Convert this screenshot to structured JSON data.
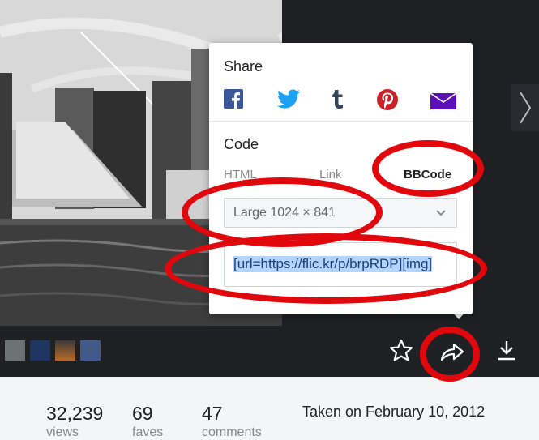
{
  "share": {
    "heading": "Share",
    "services": [
      {
        "name": "facebook-icon",
        "color": "#3b5998"
      },
      {
        "name": "twitter-icon",
        "color": "#1da1f2"
      },
      {
        "name": "tumblr-icon",
        "color": "#35465c"
      },
      {
        "name": "pinterest-icon",
        "color": "#cb2027"
      },
      {
        "name": "email-icon",
        "color": "#5c0fb4"
      }
    ]
  },
  "code": {
    "heading": "Code",
    "tabs": [
      "HTML",
      "Link",
      "BBCode"
    ],
    "active_tab": "BBCode",
    "size_select": "Large 1024 × 841",
    "embed_text": "[url=https://flic.kr/p/brpRDP][img]"
  },
  "annotation_color": "#e0070d",
  "stats": [
    {
      "value": "32,239",
      "label": "views"
    },
    {
      "value": "69",
      "label": "faves"
    },
    {
      "value": "47",
      "label": "comments"
    }
  ],
  "taken_on": "Taken on February 10, 2012"
}
